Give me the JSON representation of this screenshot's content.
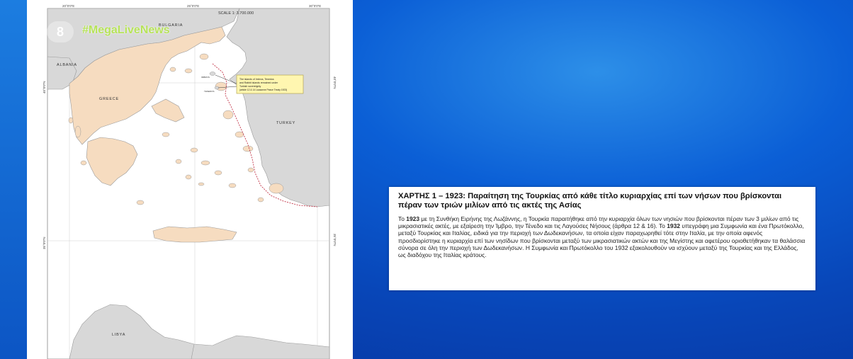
{
  "overlay": {
    "logo_text": "8",
    "hashtag": "#MegaLiveNews"
  },
  "map": {
    "scale": "SCALE 1: 3.700.000",
    "top_ticks": [
      "20°0'0\"E",
      "25°0'0\"E",
      "30°0'0\"E"
    ],
    "left_ticks": [
      "40°0'0\"N",
      "35°0'0\"N"
    ],
    "right_ticks": [
      "40°0'0\"N",
      "35°0'0\"N"
    ],
    "labels": {
      "bulgaria": "BULGARIA",
      "albania": "ALBANIA",
      "greece": "GREECE",
      "turkey": "TURKEY",
      "libya": "LIBYA"
    },
    "annotation_lines": [
      "The islands of Imbros, Tenedos",
      "and Rabbit islands remained under",
      "Turkish sovereignty",
      "(article 12 & 14 Lausanne Peace Treaty 1923)"
    ],
    "island_labels": [
      "IMBROS",
      "TENEDOS"
    ],
    "colors": {
      "greece": "#f6dcc0",
      "neighbors": "#d8d8d8",
      "sea": "#ffffff",
      "boundary": "#c8485a",
      "annotation_bg": "#fff6b0"
    }
  },
  "caption": {
    "title": "ΧΑΡΤΗΣ 1 – 1923: Παραίτηση της Τουρκίας από κάθε τίτλο κυριαρχίας επί των νήσων που βρίσκονται πέραν των τριών μιλίων από τις ακτές της Ασίας",
    "p1_a": "Το ",
    "p1_b": "1923",
    "p1_c": " με τη Συνθήκη Ειρήνης της Λωζάννης, η Τουρκία παραιτήθηκε από την κυριαρχία όλων των νησιών που βρίσκονται πέραν των 3 μιλίων από τις μικρασιατικές ακτές, με εξαίρεση την Ίμβρο, την Τένεδο και τις Λαγούσες Νήσους (άρθρα 12 & 16). Το ",
    "p1_d": "1932",
    "p1_e": " υπεγράφη μια Συμφωνία και ένα Πρωτόκολλο, μεταξύ Τουρκίας και Ιταλίας, ειδικά για την περιοχή των Δωδεκανήσων, τα οποία είχαν παραχωρηθεί τότε στην Ιταλία, με την οποία αφενός προσδιορίστηκε η κυριαρχία επί των νησίδων που βρίσκονται μεταξύ των μικρασιατικών ακτών και της Μεγίστης και αφετέρου οριοθετήθηκαν τα θαλάσσια σύνορα σε όλη την περιοχή των Δωδεκανήσων. Η Συμφωνία και Πρωτόκολλο του 1932 εξακολουθούν να ισχύουν μεταξύ της Τουρκίας και της Ελλάδος, ως διαδόχου της Ιταλίας κράτους."
  }
}
